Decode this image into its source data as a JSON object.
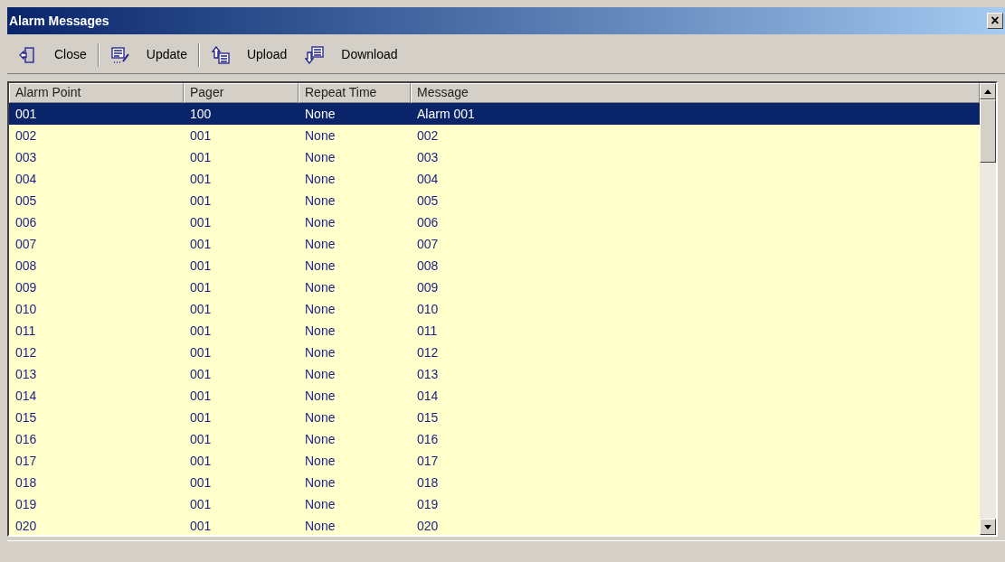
{
  "window": {
    "title": "Alarm Messages",
    "close": "×"
  },
  "toolbar": [
    {
      "label": "Close",
      "kind": "close"
    },
    {
      "label": "Update",
      "kind": "update"
    },
    {
      "label": "Upload",
      "kind": "upload"
    },
    {
      "label": "Download",
      "kind": "download"
    }
  ],
  "table": {
    "columns": [
      "Alarm Point",
      "Pager",
      "Repeat Time",
      "Message"
    ],
    "rows": [
      {
        "cells": [
          "001",
          "100",
          "None",
          "Alarm 001"
        ],
        "selected": true
      },
      {
        "cells": [
          "002",
          "001",
          "None",
          "002"
        ],
        "selected": false
      },
      {
        "cells": [
          "003",
          "001",
          "None",
          "003"
        ],
        "selected": false
      },
      {
        "cells": [
          "004",
          "001",
          "None",
          "004"
        ],
        "selected": false
      },
      {
        "cells": [
          "005",
          "001",
          "None",
          "005"
        ],
        "selected": false
      },
      {
        "cells": [
          "006",
          "001",
          "None",
          "006"
        ],
        "selected": false
      },
      {
        "cells": [
          "007",
          "001",
          "None",
          "007"
        ],
        "selected": false
      },
      {
        "cells": [
          "008",
          "001",
          "None",
          "008"
        ],
        "selected": false
      },
      {
        "cells": [
          "009",
          "001",
          "None",
          "009"
        ],
        "selected": false
      },
      {
        "cells": [
          "010",
          "001",
          "None",
          "010"
        ],
        "selected": false
      },
      {
        "cells": [
          "011",
          "001",
          "None",
          "011"
        ],
        "selected": false
      },
      {
        "cells": [
          "012",
          "001",
          "None",
          "012"
        ],
        "selected": false
      },
      {
        "cells": [
          "013",
          "001",
          "None",
          "013"
        ],
        "selected": false
      },
      {
        "cells": [
          "014",
          "001",
          "None",
          "014"
        ],
        "selected": false
      },
      {
        "cells": [
          "015",
          "001",
          "None",
          "015"
        ],
        "selected": false
      },
      {
        "cells": [
          "016",
          "001",
          "None",
          "016"
        ],
        "selected": false
      },
      {
        "cells": [
          "017",
          "001",
          "None",
          "017"
        ],
        "selected": false
      },
      {
        "cells": [
          "018",
          "001",
          "None",
          "018"
        ],
        "selected": false
      },
      {
        "cells": [
          "019",
          "001",
          "None",
          "019"
        ],
        "selected": false
      },
      {
        "cells": [
          "020",
          "001",
          "None",
          "020"
        ],
        "selected": false
      }
    ]
  }
}
